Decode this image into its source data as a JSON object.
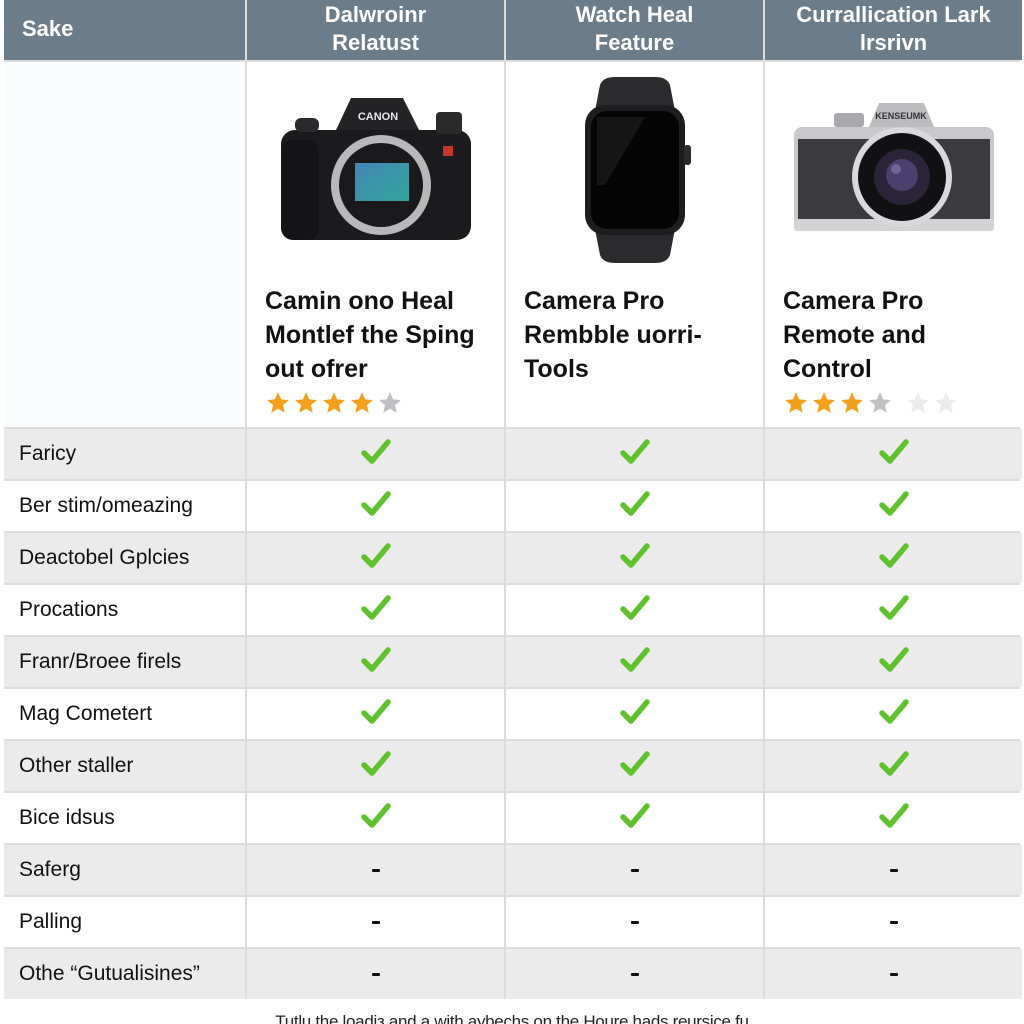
{
  "colors": {
    "header_bg": "#6b7d8a",
    "check_green": "#5ec22b",
    "star_filled": "#f5a01a",
    "star_empty": "#bfbfc4",
    "star_faint": "#ececee",
    "row_shaded": "#ebebec"
  },
  "header": {
    "col0": "Sake",
    "col1": "Dalwroinr\nRelatust",
    "col2": "Watch Heal\nFeature",
    "col3": "Currallication Lark\nlrsrivn"
  },
  "products": [
    {
      "image": "dslr-camera-image",
      "brand_text": "CANON",
      "name": "Camin ono Heal Montlef the Sping out ofrer",
      "rating": 4,
      "rating_max": 5,
      "faint_stars": 0
    },
    {
      "image": "smartwatch-image",
      "name": "Camera Pro Rembble uorri-Tools",
      "rating": null,
      "rating_max": 0,
      "faint_stars": 0
    },
    {
      "image": "mirrorless-camera-image",
      "brand_text": "KENSEUMK",
      "name": "Camera Pro Remote and Control",
      "rating": 3,
      "rating_max": 4,
      "faint_stars": 2
    }
  ],
  "features": [
    {
      "label": "Faricy",
      "values": [
        "check",
        "check",
        "check"
      ]
    },
    {
      "label": "Ber stim/omeazing",
      "values": [
        "check",
        "check",
        "check"
      ]
    },
    {
      "label": "Deactobel Gplcies",
      "values": [
        "check",
        "check",
        "check"
      ]
    },
    {
      "label": "Procations",
      "values": [
        "check",
        "check",
        "check"
      ]
    },
    {
      "label": "Franr/Broee firels",
      "values": [
        "check",
        "check",
        "check"
      ]
    },
    {
      "label": "Mag Cometert",
      "values": [
        "check",
        "check",
        "check"
      ]
    },
    {
      "label": "Other staller",
      "values": [
        "check",
        "check",
        "check"
      ]
    },
    {
      "label": "Bice idsus",
      "values": [
        "check",
        "check",
        "check"
      ]
    },
    {
      "label": "Saferg",
      "values": [
        "dash",
        "dash",
        "dash"
      ]
    },
    {
      "label": "Palling",
      "values": [
        "dash",
        "dash",
        "dash"
      ]
    },
    {
      "label": "Othe “Gutualisines”",
      "values": [
        "dash",
        "dash",
        "dash"
      ]
    }
  ],
  "caption": "Tutlu the loadiз and a with aybechs on the Houre hads reursice fu"
}
